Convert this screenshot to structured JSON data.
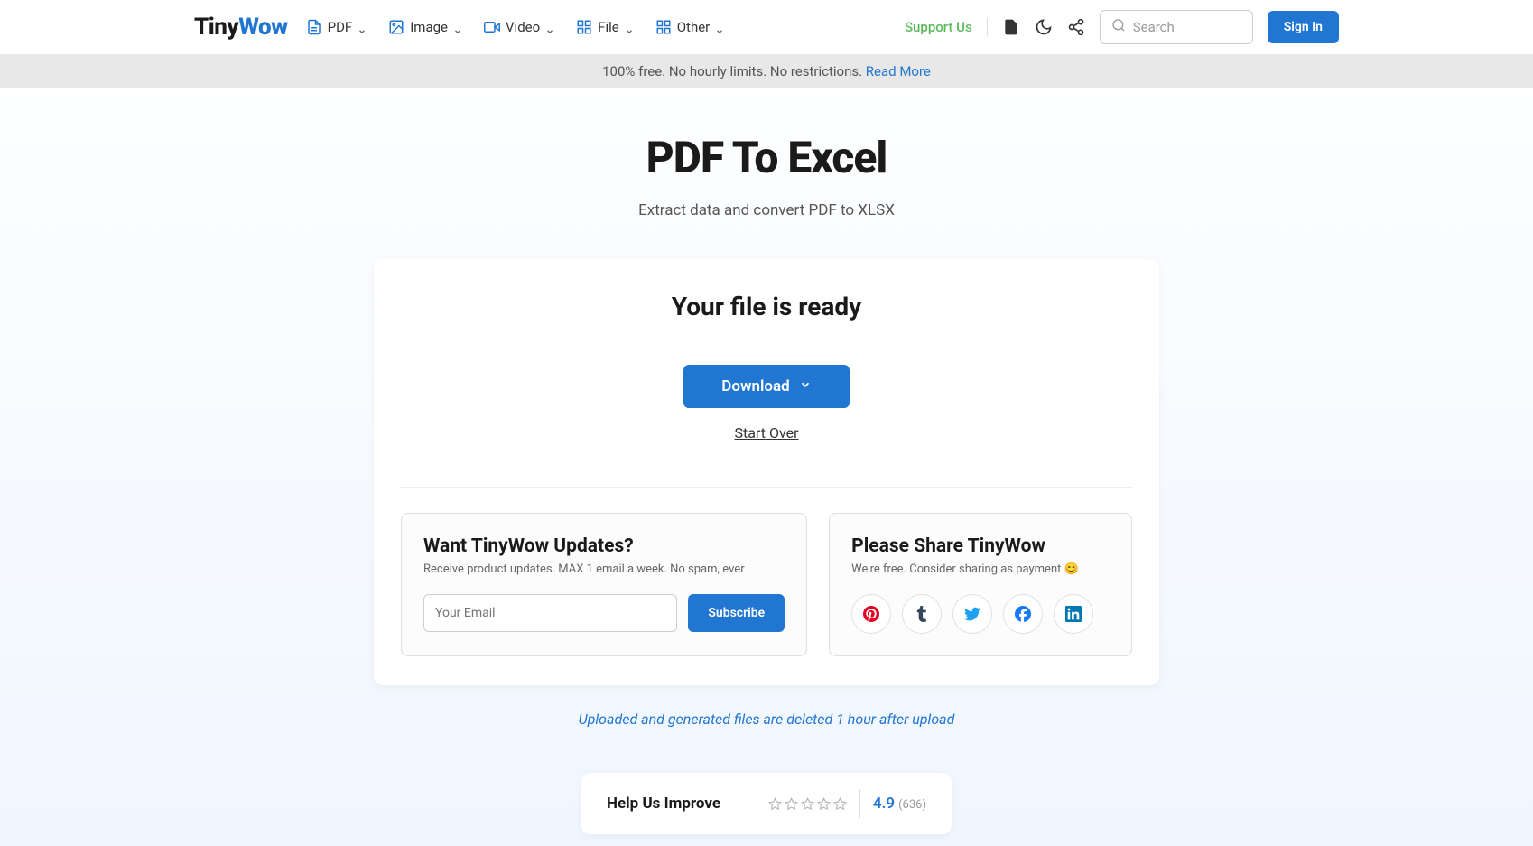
{
  "logo": {
    "part1": "Tiny",
    "part2": "Wow"
  },
  "nav": {
    "items": [
      {
        "label": "PDF"
      },
      {
        "label": "Image"
      },
      {
        "label": "Video"
      },
      {
        "label": "File"
      },
      {
        "label": "Other"
      }
    ]
  },
  "header": {
    "support": "Support Us",
    "search_placeholder": "Search",
    "signin": "Sign In"
  },
  "banner": {
    "text": "100% free. No hourly limits. No restrictions. ",
    "link": "Read More"
  },
  "page": {
    "title": "PDF To Excel",
    "subtitle": "Extract data and convert PDF to XLSX"
  },
  "card": {
    "title": "Your file is ready",
    "download": "Download",
    "start_over": "Start Over"
  },
  "updates_panel": {
    "title": "Want TinyWow Updates?",
    "subtitle": "Receive product updates. MAX 1 email a week. No spam, ever",
    "email_placeholder": "Your Email",
    "subscribe": "Subscribe"
  },
  "share_panel": {
    "title": "Please Share TinyWow",
    "subtitle": "We're free. Consider sharing as payment 😊"
  },
  "footer_note": "Uploaded and generated files are deleted 1 hour after upload",
  "rating": {
    "title": "Help Us Improve",
    "score": "4.9",
    "count": "(636)"
  }
}
